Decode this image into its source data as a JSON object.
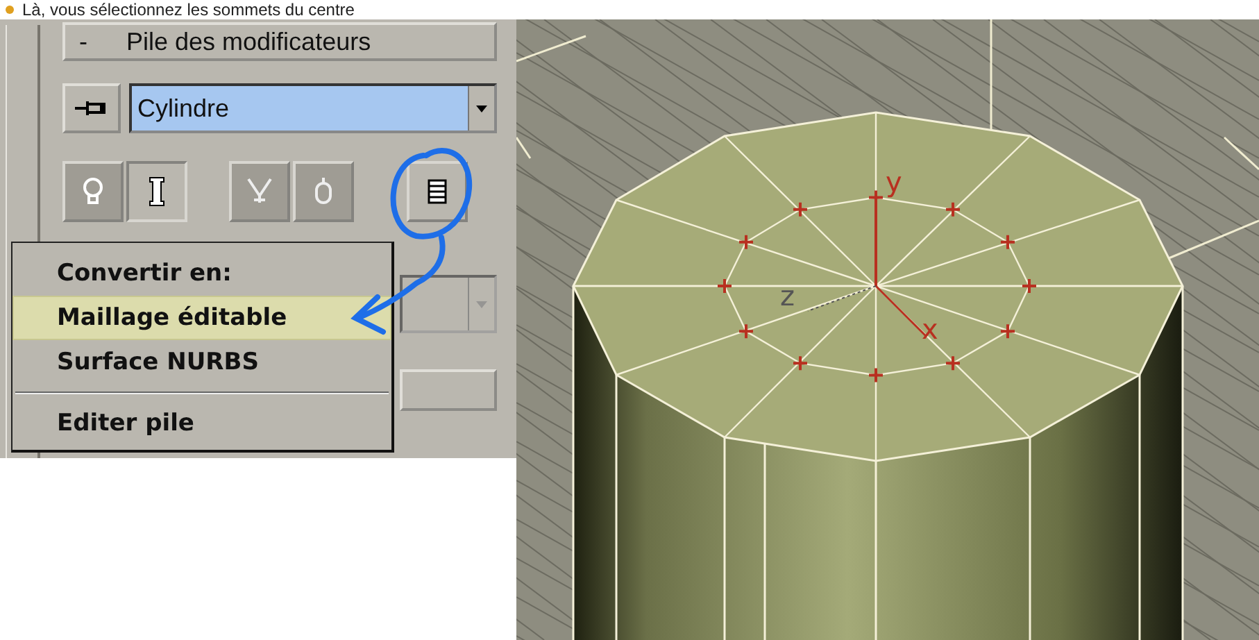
{
  "caption": {
    "text": "Là, vous sélectionnez les sommets du centre"
  },
  "modifier_panel": {
    "rollout_title": "Pile des modificateurs",
    "collapse_symbol": "-",
    "modifier_dropdown": {
      "value": "Cylindre"
    },
    "tool_buttons": [
      {
        "pressed": false
      },
      {
        "pressed": true
      },
      {
        "pressed": false
      },
      {
        "pressed": false
      },
      {
        "pressed": false
      }
    ],
    "lower_dropdown": {
      "disabled": true
    }
  },
  "context_menu": {
    "items": [
      {
        "kind": "header",
        "label": "Convertir en:"
      },
      {
        "kind": "item",
        "label": "Maillage éditable",
        "selected": true
      },
      {
        "kind": "item",
        "label": "Surface NURBS",
        "selected": false
      },
      {
        "kind": "separator"
      },
      {
        "kind": "item",
        "label": "Editer pile",
        "selected": false
      }
    ]
  },
  "viewport": {
    "gizmo": {
      "y_label": "y",
      "x_label": "x",
      "z_label": "z"
    }
  }
}
